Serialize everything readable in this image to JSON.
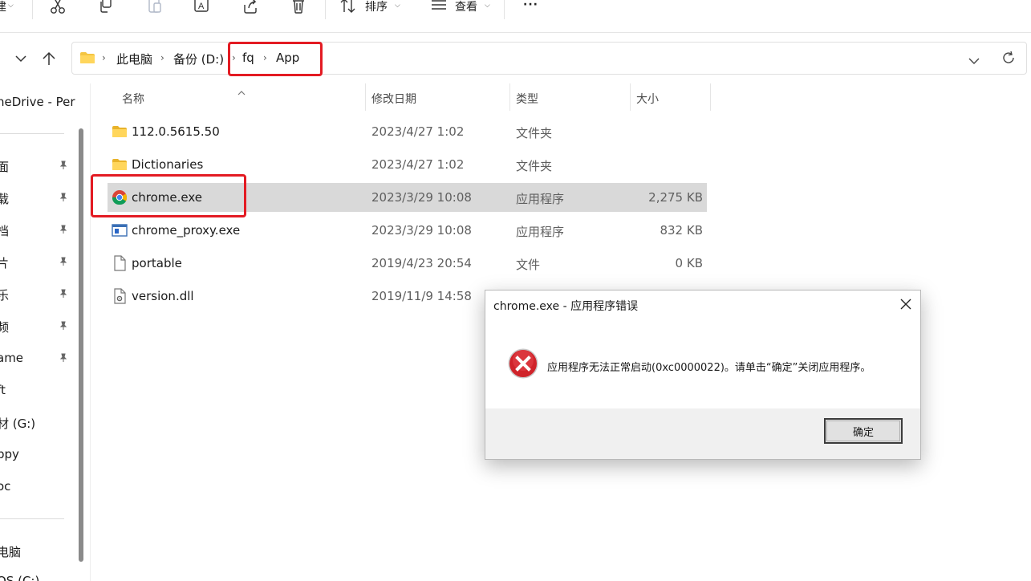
{
  "toolbar": {
    "left_fragment": "建",
    "sort_label": "排序",
    "view_label": "查看",
    "more_label": "···"
  },
  "breadcrumb": [
    "此电脑",
    "备份 (D:)",
    "fq",
    "App"
  ],
  "sidebar": {
    "items": [
      {
        "label": "neDrive - Per",
        "pinned": false
      },
      {
        "label": "面",
        "pinned": true
      },
      {
        "label": "载",
        "pinned": true
      },
      {
        "label": "档",
        "pinned": true
      },
      {
        "label": "片",
        "pinned": true
      },
      {
        "label": "乐",
        "pinned": true
      },
      {
        "label": "频",
        "pinned": true
      },
      {
        "label": "ame",
        "pinned": true
      },
      {
        "label": "ft",
        "pinned": false
      },
      {
        "label": "材 (G:)",
        "pinned": false
      },
      {
        "label": "ppy",
        "pinned": false
      },
      {
        "label": "oc",
        "pinned": false
      },
      {
        "label": "电脑",
        "pinned": false
      },
      {
        "label": "OS (C:)",
        "pinned": false
      }
    ]
  },
  "columns": {
    "name": "名称",
    "date": "修改日期",
    "type": "类型",
    "size": "大小"
  },
  "files": [
    {
      "name": "112.0.5615.50",
      "date": "2023/4/27 1:02",
      "type": "文件夹",
      "size": "",
      "icon": "folder-icon"
    },
    {
      "name": "Dictionaries",
      "date": "2023/4/27 1:02",
      "type": "文件夹",
      "size": "",
      "icon": "folder-icon"
    },
    {
      "name": "chrome.exe",
      "date": "2023/3/29 10:08",
      "type": "应用程序",
      "size": "2,275 KB",
      "icon": "chrome-icon"
    },
    {
      "name": "chrome_proxy.exe",
      "date": "2023/3/29 10:08",
      "type": "应用程序",
      "size": "832 KB",
      "icon": "app-window-icon"
    },
    {
      "name": "portable",
      "date": "2019/4/23 20:54",
      "type": "文件",
      "size": "0 KB",
      "icon": "file-icon"
    },
    {
      "name": "version.dll",
      "date": "2019/11/9 14:58",
      "type": "",
      "size": "",
      "icon": "dll-file-icon"
    }
  ],
  "dialog": {
    "title": "chrome.exe - 应用程序错误",
    "message": "应用程序无法正常启动(0xc0000022)。请单击“确定”关闭应用程序。",
    "ok_label": "确定"
  },
  "colors": {
    "highlight_annotation": "#e31b23",
    "selected_row": "#d9d9d9",
    "folder": "#f4c542",
    "error_icon": "#d0232a"
  }
}
